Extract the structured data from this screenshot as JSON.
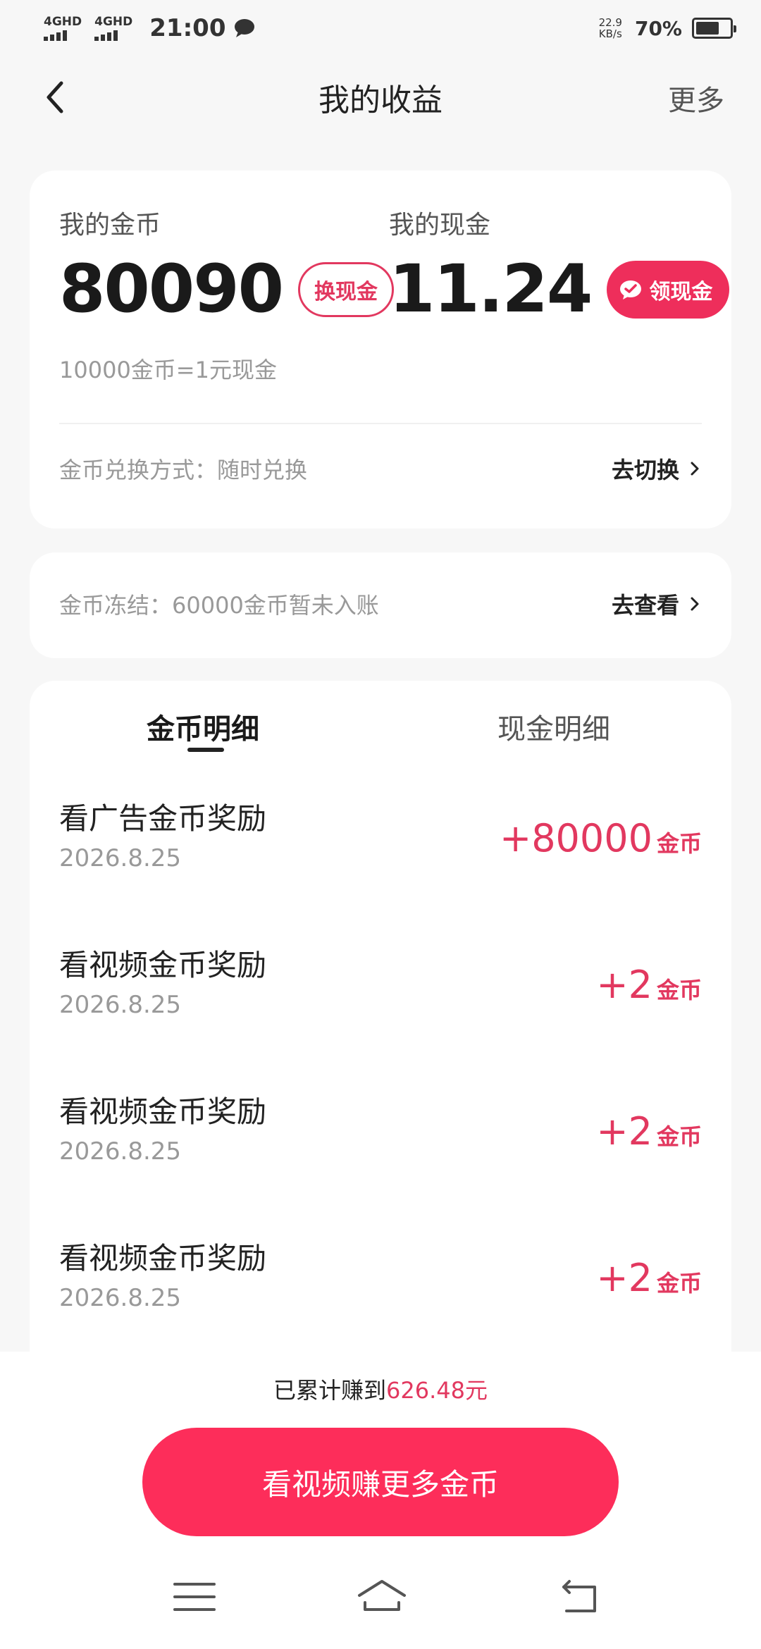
{
  "status_bar": {
    "signal1": "4GHD",
    "signal2": "4GHD",
    "time": "21:00",
    "net_speed_value": "22.9",
    "net_speed_unit": "KB/s",
    "battery_percent": "70%",
    "battery_level": 0.7
  },
  "nav": {
    "title": "我的收益",
    "more": "更多"
  },
  "earnings": {
    "coins_label": "我的金币",
    "coins_value": "80090",
    "exchange_button": "换现金",
    "cash_label": "我的现金",
    "cash_value": "11.24",
    "withdraw_button": "领现金",
    "rate_note": "10000金币=1元现金",
    "exchange_mode_text": "金币兑换方式：随时兑换",
    "switch_action": "去切换"
  },
  "freeze": {
    "text": "金币冻结：60000金币暂未入账",
    "action": "去查看"
  },
  "detail": {
    "tabs": [
      "金币明细",
      "现金明细"
    ],
    "active_tab": 0,
    "records": [
      {
        "title": "看广告金币奖励",
        "date": "2026.8.25",
        "amount": "+80000",
        "unit": "金币"
      },
      {
        "title": "看视频金币奖励",
        "date": "2026.8.25",
        "amount": "+2",
        "unit": "金币"
      },
      {
        "title": "看视频金币奖励",
        "date": "2026.8.25",
        "amount": "+2",
        "unit": "金币"
      },
      {
        "title": "看视频金币奖励",
        "date": "2026.8.25",
        "amount": "+2",
        "unit": "金币"
      }
    ]
  },
  "footer": {
    "total_prefix": "已累计赚到",
    "total_value": "626.48元",
    "cta": "看视频赚更多金币"
  },
  "colors": {
    "accent": "#e2385f",
    "cta": "#fd2d5a",
    "background": "#f7f7f7"
  }
}
